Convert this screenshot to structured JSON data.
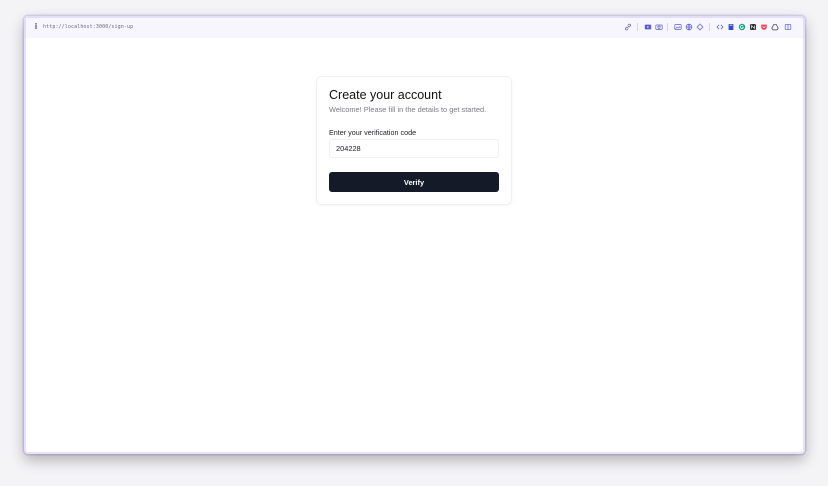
{
  "browser": {
    "url": "http://localhost:3000/sign-up",
    "info_icon": "info-icon",
    "toolbar_icons": [
      "link-icon",
      "screencast-icon",
      "camera-icon",
      "image-icon",
      "globe-icon",
      "target-icon",
      "code-icon",
      "book-icon",
      "grammarly-icon",
      "notion-icon",
      "pocket-icon",
      "drive-icon",
      "sidebar-icon"
    ],
    "colors": {
      "frame_border": "#d9d3f0",
      "toolbar_background": "#f7f6fd",
      "icon_accent": "#5b5bd6"
    }
  },
  "signup": {
    "title": "Create your account",
    "subtitle": "Welcome! Please fill in the details to get started.",
    "verification": {
      "label": "Enter your verification code",
      "value": "204228",
      "placeholder": ""
    },
    "verify_label": "Verify",
    "colors": {
      "button_background": "#141a27",
      "button_text": "#ffffff",
      "title_text": "#111111",
      "subtitle_text": "#7b7b84"
    }
  }
}
